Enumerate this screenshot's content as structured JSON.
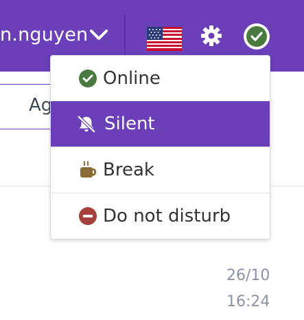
{
  "header": {
    "username": "n.nguyen",
    "colors": {
      "bar": "#6a3fb8",
      "status_green": "#4a7a3f"
    }
  },
  "background": {
    "tab_label": "Ag",
    "date": "26/10",
    "time": "16:24"
  },
  "status_menu": {
    "items": [
      {
        "label": "Online",
        "icon": "check-circle-icon",
        "color": "#4a7a3f"
      },
      {
        "label": "Silent",
        "icon": "bell-slash-icon",
        "color": "#ffffff",
        "selected": true
      },
      {
        "label": "Break",
        "icon": "coffee-cup-icon",
        "color": "#8a6a35"
      },
      {
        "label": "Do not disturb",
        "icon": "minus-circle-icon",
        "color": "#a5403a"
      }
    ]
  }
}
